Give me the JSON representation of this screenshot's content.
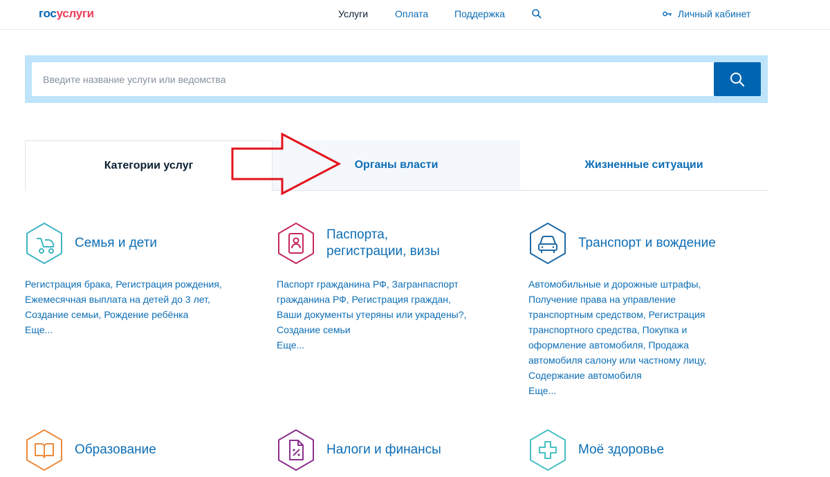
{
  "header": {
    "logo_gos": "гос",
    "logo_uslugi": "услуги",
    "nav": [
      {
        "label": "Услуги"
      },
      {
        "label": "Оплата"
      },
      {
        "label": "Поддержка"
      }
    ],
    "account_label": "Личный кабинет"
  },
  "search": {
    "placeholder": "Введите название услуги или ведомства",
    "value": ""
  },
  "tabs": [
    {
      "label": "Категории услуг",
      "active": true
    },
    {
      "label": "Органы власти",
      "active": false
    },
    {
      "label": "Жизненные ситуации",
      "active": false
    }
  ],
  "categories": [
    {
      "title_lines": [
        "Семья и дети"
      ],
      "icon": "baby-stroller-icon",
      "color": "#3fb6c2",
      "links": [
        "Регистрация брака, Регистрация рождения,",
        "Ежемесячная выплата на детей до 3 лет,",
        "Создание семьи, Рождение ребёнка"
      ],
      "more": "Еще..."
    },
    {
      "title_lines": [
        "Паспорта,",
        "регистрации, визы"
      ],
      "icon": "passport-icon",
      "color": "#c5285e",
      "links": [
        "Паспорт гражданина РФ, Загранпаспорт",
        "гражданина РФ, Регистрация граждан,",
        "Ваши документы утеряны или украдены?,",
        "Создание семьи"
      ],
      "more": "Еще..."
    },
    {
      "title_lines": [
        "Транспорт и вождение"
      ],
      "icon": "car-icon",
      "color": "#1d6aa6",
      "links": [
        "Автомобильные и дорожные штрафы,",
        "Получение права на управление",
        "транспортным средством, Регистрация",
        "транспортного средства, Покупка и",
        "оформление автомобиля, Продажа",
        "автомобиля салону или частному лицу,",
        "Содержание автомобиля"
      ],
      "more": "Еще..."
    },
    {
      "title_lines": [
        "Образование"
      ],
      "icon": "book-icon",
      "color": "#ec8a3c"
    },
    {
      "title_lines": [
        "Налоги и финансы"
      ],
      "icon": "tax-document-icon",
      "color": "#8a2f8c"
    },
    {
      "title_lines": [
        "Моё здоровье"
      ],
      "icon": "medical-cross-icon",
      "color": "#48bfc4"
    }
  ],
  "colors": {
    "brand_blue": "#0065b1",
    "brand_red": "#ee3f58",
    "link_blue": "#0d6eb5",
    "search_band": "#bde4fb",
    "annotation_arrow": "#e3121b"
  }
}
